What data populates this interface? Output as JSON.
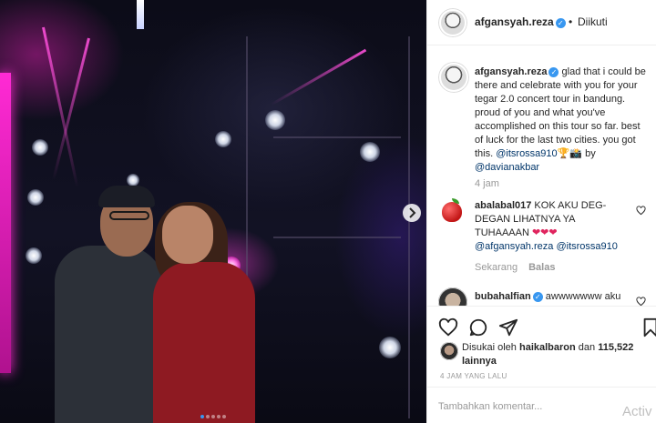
{
  "post": {
    "carousel": {
      "next_icon": "chevron-right-icon",
      "dot_count": 5,
      "active_index": 0
    }
  },
  "header": {
    "username": "afgansyah.reza",
    "verified_icon": "verified-badge-icon",
    "separator": "•",
    "follow_status": "Diikuti"
  },
  "caption": {
    "username": "afgansyah.reza",
    "text_part1": " glad that i could be there and celebrate with you for your tegar 2.0 concert tour in bandung. proud of you and what you've accomplished on this tour so far. best of luck for the last two cities. you got this. ",
    "mention1": "@itsrossa910",
    "emoji": "🏆📸",
    "text_part2": " by",
    "mention2": "@davianakbar",
    "time": "4 jam"
  },
  "comments": [
    {
      "username": "abalabal017",
      "text": " KOK AKU DEG-DEGAN LIHATNYA YA TUHAAAAN ",
      "hearts": "❤❤❤",
      "mention1": "@afgansyah.reza",
      "mention2": "@itsrossa910",
      "time": "Sekarang",
      "reply_label": "Balas"
    },
    {
      "username": "bubahalfian",
      "text": " awwwwwww aku"
    }
  ],
  "actions": {
    "like_icon": "heart-icon",
    "comment_icon": "comment-icon",
    "share_icon": "share-icon",
    "save_icon": "bookmark-icon"
  },
  "likes": {
    "prefix": "Disukai oleh ",
    "first_user": "haikalbaron",
    "middle": " dan ",
    "count": "115,522",
    "suffix": " lainnya"
  },
  "post_time": "4 JAM YANG LALU",
  "add_comment": {
    "placeholder": "Tambahkan komentar..."
  },
  "watermark": "Activ",
  "colors": {
    "link": "#003569",
    "verified": "#3897f0",
    "muted": "#999999",
    "accent_stage": "#ff2ad4"
  }
}
